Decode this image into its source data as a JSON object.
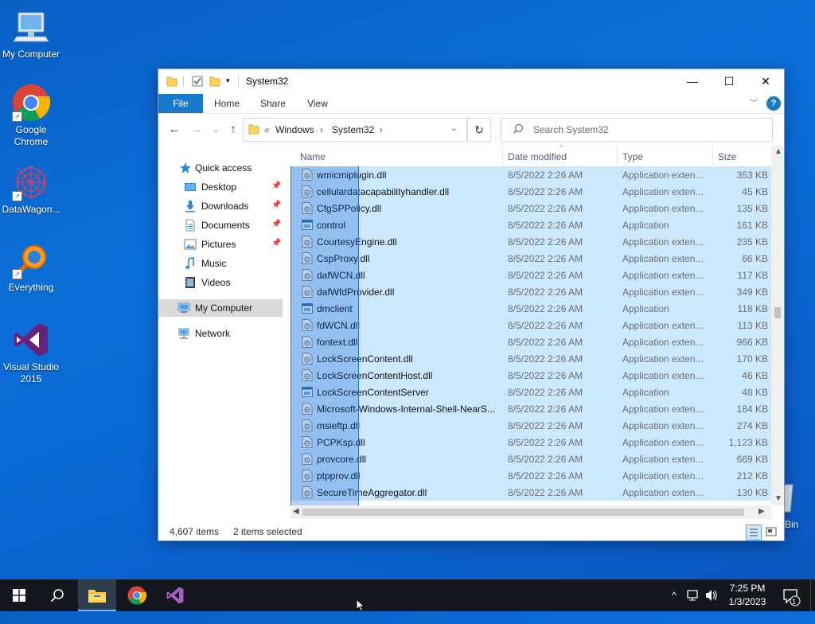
{
  "desktop": {
    "icons": [
      {
        "label": "My Computer",
        "icon": "computer-icon"
      },
      {
        "label": "Google Chrome",
        "icon": "chrome-icon"
      },
      {
        "label": "DataWagon...",
        "icon": "datawagon-icon"
      },
      {
        "label": "Everything",
        "icon": "everything-search-icon"
      },
      {
        "label": "Visual Studio 2015",
        "icon": "visual-studio-icon"
      }
    ],
    "recycle_bin_label": "Bin"
  },
  "window": {
    "title": "System32",
    "controls": {
      "minimize": "—",
      "maximize": "☐",
      "close": "✕"
    },
    "ribbon_tabs": [
      "File",
      "Home",
      "Share",
      "View"
    ],
    "address": {
      "prefix": "«",
      "crumbs": [
        "Windows",
        "System32"
      ]
    },
    "search": {
      "placeholder": "Search System32"
    },
    "nav": {
      "items": [
        {
          "label": "Quick access",
          "icon": "star-icon"
        },
        {
          "label": "Desktop",
          "icon": "desktop-folder-icon",
          "pinned": true
        },
        {
          "label": "Downloads",
          "icon": "downloads-icon",
          "pinned": true
        },
        {
          "label": "Documents",
          "icon": "documents-icon",
          "pinned": true
        },
        {
          "label": "Pictures",
          "icon": "pictures-icon",
          "pinned": true
        },
        {
          "label": "Music",
          "icon": "music-icon"
        },
        {
          "label": "Videos",
          "icon": "videos-icon"
        },
        {
          "label": "My Computer",
          "icon": "computer-icon",
          "selected": true
        },
        {
          "label": "Network",
          "icon": "network-icon"
        }
      ]
    },
    "columns": [
      "Name",
      "Date modified",
      "Type",
      "Size"
    ],
    "files": [
      {
        "name": "wmicmiplugin.dll",
        "date": "8/5/2022 2:26 AM",
        "type": "Application exten...",
        "size": "353 KB",
        "kind": "dll"
      },
      {
        "name": "cellulardatacapabilityhandler.dll",
        "date": "8/5/2022 2:26 AM",
        "type": "Application exten...",
        "size": "45 KB",
        "kind": "dll"
      },
      {
        "name": "CfgSPPolicy.dll",
        "date": "8/5/2022 2:26 AM",
        "type": "Application exten...",
        "size": "135 KB",
        "kind": "dll"
      },
      {
        "name": "control",
        "date": "8/5/2022 2:26 AM",
        "type": "Application",
        "size": "161 KB",
        "kind": "app"
      },
      {
        "name": "CourtesyEngine.dll",
        "date": "8/5/2022 2:26 AM",
        "type": "Application exten...",
        "size": "235 KB",
        "kind": "dll"
      },
      {
        "name": "CspProxy.dll",
        "date": "8/5/2022 2:26 AM",
        "type": "Application exten...",
        "size": "66 KB",
        "kind": "dll"
      },
      {
        "name": "dafWCN.dll",
        "date": "8/5/2022 2:26 AM",
        "type": "Application exten...",
        "size": "117 KB",
        "kind": "dll"
      },
      {
        "name": "dafWfdProvider.dll",
        "date": "8/5/2022 2:26 AM",
        "type": "Application exten...",
        "size": "349 KB",
        "kind": "dll"
      },
      {
        "name": "dmclient",
        "date": "8/5/2022 2:26 AM",
        "type": "Application",
        "size": "118 KB",
        "kind": "app"
      },
      {
        "name": "fdWCN.dll",
        "date": "8/5/2022 2:26 AM",
        "type": "Application exten...",
        "size": "113 KB",
        "kind": "dll"
      },
      {
        "name": "fontext.dll",
        "date": "8/5/2022 2:26 AM",
        "type": "Application exten...",
        "size": "966 KB",
        "kind": "dll"
      },
      {
        "name": "LockScreenContent.dll",
        "date": "8/5/2022 2:26 AM",
        "type": "Application exten...",
        "size": "170 KB",
        "kind": "dll"
      },
      {
        "name": "LockScreenContentHost.dll",
        "date": "8/5/2022 2:26 AM",
        "type": "Application exten...",
        "size": "46 KB",
        "kind": "dll"
      },
      {
        "name": "LockScreenContentServer",
        "date": "8/5/2022 2:26 AM",
        "type": "Application",
        "size": "48 KB",
        "kind": "app"
      },
      {
        "name": "Microsoft-Windows-Internal-Shell-NearS...",
        "date": "8/5/2022 2:26 AM",
        "type": "Application exten...",
        "size": "184 KB",
        "kind": "dll"
      },
      {
        "name": "msieftp.dll",
        "date": "8/5/2022 2:26 AM",
        "type": "Application exten...",
        "size": "274 KB",
        "kind": "dll"
      },
      {
        "name": "PCPKsp.dll",
        "date": "8/5/2022 2:26 AM",
        "type": "Application exten...",
        "size": "1,123 KB",
        "kind": "dll"
      },
      {
        "name": "provcore.dll",
        "date": "8/5/2022 2:26 AM",
        "type": "Application exten...",
        "size": "669 KB",
        "kind": "dll"
      },
      {
        "name": "ptpprov.dll",
        "date": "8/5/2022 2:26 AM",
        "type": "Application exten...",
        "size": "212 KB",
        "kind": "dll"
      },
      {
        "name": "SecureTimeAggregator.dll",
        "date": "8/5/2022 2:26 AM",
        "type": "Application exten...",
        "size": "130 KB",
        "kind": "dll"
      }
    ],
    "status": {
      "count": "4,607 items",
      "selected": "2 items selected"
    }
  },
  "taskbar": {
    "apps": [
      {
        "name": "start-button",
        "icon": "windows-logo-icon"
      },
      {
        "name": "search-button",
        "icon": "search-icon"
      },
      {
        "name": "file-explorer-button",
        "icon": "folder-icon",
        "active": true
      },
      {
        "name": "chrome-button",
        "icon": "chrome-icon"
      },
      {
        "name": "visual-studio-button",
        "icon": "visual-studio-icon"
      }
    ],
    "tray": {
      "chevron": "^",
      "time": "7:25 PM",
      "date": "1/3/2023",
      "notifications": "1"
    }
  },
  "colors": {
    "accent": "#1979ca",
    "selection": "#cce8ff",
    "desktop": "#0b6fd9",
    "taskbar": "#14181e"
  }
}
